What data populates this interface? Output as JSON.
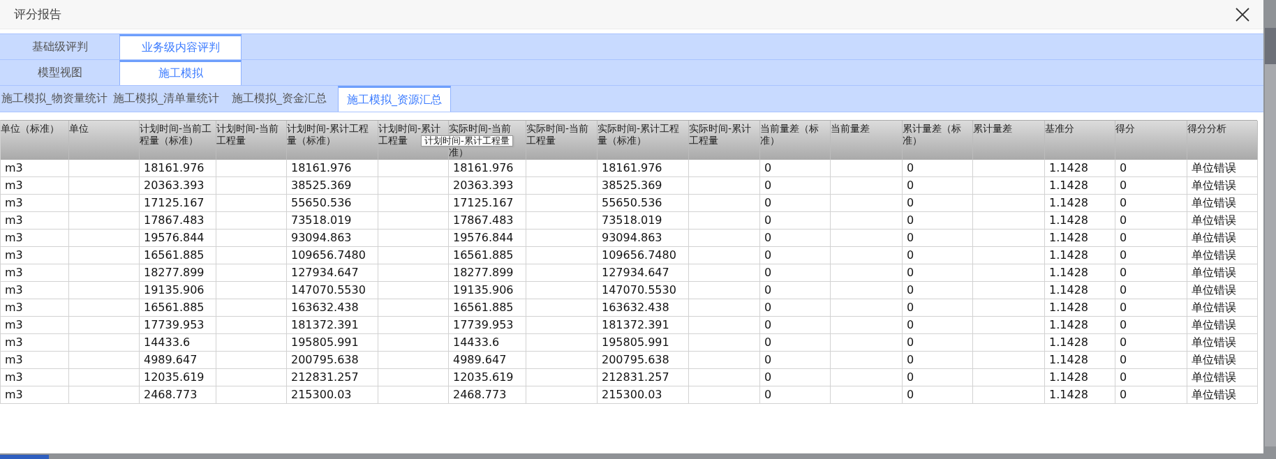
{
  "window": {
    "title": "评分报告"
  },
  "tab_rows": [
    {
      "label": "基础级评判",
      "tabs": [
        {
          "label": "业务级内容评判",
          "selected": true
        }
      ]
    },
    {
      "label": "模型视图",
      "tabs": [
        {
          "label": "施工模拟",
          "selected": true
        }
      ]
    }
  ],
  "sub_tabs": [
    {
      "label": "施工模拟_物资量统计",
      "selected": false
    },
    {
      "label": "施工模拟_清单量统计",
      "selected": false
    },
    {
      "label": "施工模拟_资金汇总",
      "selected": false
    },
    {
      "label": "施工模拟_资源汇总",
      "selected": true
    }
  ],
  "table": {
    "columns": [
      "单位（标准）",
      "单位",
      "计划时间-当前工程量（标准）",
      "计划时间-当前工程量",
      "计划时间-累计工程量（标准）",
      "计划时间-累计工程量",
      [
        "实际时间-当前",
        "准）"
      ],
      "实际时间-当前工程量",
      "实际时间-累计工程量（标准）",
      "实际时间-累计工程量",
      "当前量差（标准）",
      "当前量差",
      "累计量差（标准）",
      "累计量差",
      "基准分",
      "得分",
      "得分分析"
    ],
    "rows": [
      [
        "m3",
        null,
        "18161.976",
        null,
        "18161.976",
        null,
        "18161.976",
        null,
        "18161.976",
        null,
        "0",
        null,
        "0",
        null,
        "1.1428",
        "0",
        "单位错误"
      ],
      [
        "m3",
        null,
        "20363.393",
        null,
        "38525.369",
        null,
        "20363.393",
        null,
        "38525.369",
        null,
        "0",
        null,
        "0",
        null,
        "1.1428",
        "0",
        "单位错误"
      ],
      [
        "m3",
        null,
        "17125.167",
        null,
        "55650.536",
        null,
        "17125.167",
        null,
        "55650.536",
        null,
        "0",
        null,
        "0",
        null,
        "1.1428",
        "0",
        "单位错误"
      ],
      [
        "m3",
        null,
        "17867.483",
        null,
        "73518.019",
        null,
        "17867.483",
        null,
        "73518.019",
        null,
        "0",
        null,
        "0",
        null,
        "1.1428",
        "0",
        "单位错误"
      ],
      [
        "m3",
        null,
        "19576.844",
        null,
        "93094.863",
        null,
        "19576.844",
        null,
        "93094.863",
        null,
        "0",
        null,
        "0",
        null,
        "1.1428",
        "0",
        "单位错误"
      ],
      [
        "m3",
        null,
        "16561.885",
        null,
        "109656.7480",
        null,
        "16561.885",
        null,
        "109656.7480",
        null,
        "0",
        null,
        "0",
        null,
        "1.1428",
        "0",
        "单位错误"
      ],
      [
        "m3",
        null,
        "18277.899",
        null,
        "127934.647",
        null,
        "18277.899",
        null,
        "127934.647",
        null,
        "0",
        null,
        "0",
        null,
        "1.1428",
        "0",
        "单位错误"
      ],
      [
        "m3",
        null,
        "19135.906",
        null,
        "147070.5530",
        null,
        "19135.906",
        null,
        "147070.5530",
        null,
        "0",
        null,
        "0",
        null,
        "1.1428",
        "0",
        "单位错误"
      ],
      [
        "m3",
        null,
        "16561.885",
        null,
        "163632.438",
        null,
        "16561.885",
        null,
        "163632.438",
        null,
        "0",
        null,
        "0",
        null,
        "1.1428",
        "0",
        "单位错误"
      ],
      [
        "m3",
        null,
        "17739.953",
        null,
        "181372.391",
        null,
        "17739.953",
        null,
        "181372.391",
        null,
        "0",
        null,
        "0",
        null,
        "1.1428",
        "0",
        "单位错误"
      ],
      [
        "m3",
        null,
        "14433.6",
        null,
        "195805.991",
        null,
        "14433.6",
        null,
        "195805.991",
        null,
        "0",
        null,
        "0",
        null,
        "1.1428",
        "0",
        "单位错误"
      ],
      [
        "m3",
        null,
        "4989.647",
        null,
        "200795.638",
        null,
        "4989.647",
        null,
        "200795.638",
        null,
        "0",
        null,
        "0",
        null,
        "1.1428",
        "0",
        "单位错误"
      ],
      [
        "m3",
        null,
        "12035.619",
        null,
        "212831.257",
        null,
        "12035.619",
        null,
        "212831.257",
        null,
        "0",
        null,
        "0",
        null,
        "1.1428",
        "0",
        "单位错误"
      ],
      [
        "m3",
        null,
        "2468.773",
        null,
        "215300.03",
        null,
        "2468.773",
        null,
        "215300.03",
        null,
        "0",
        null,
        "0",
        null,
        "1.1428",
        "0",
        "单位错误"
      ]
    ]
  },
  "tooltip": "计划时间-累计工程量"
}
